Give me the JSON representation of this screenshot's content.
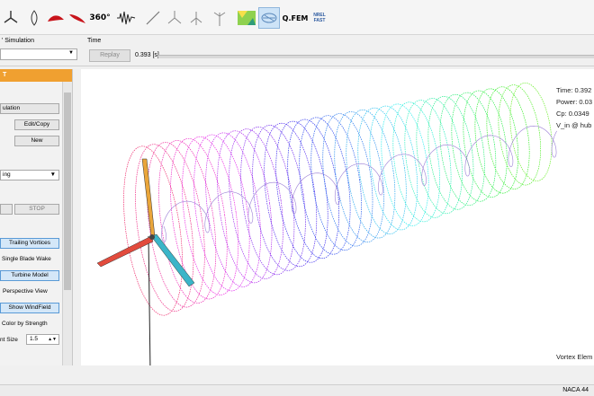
{
  "toolbar": {
    "icons": [
      "turbine-icon",
      "blade-icon",
      "airfoil-red-icon",
      "airfoil-red2-icon",
      "360-label",
      "signal-icon",
      "line-icon",
      "tripod-icon",
      "tower-icon",
      "contour-icon",
      "wake-view-icon",
      "qfem-label",
      "nrel-fast-label"
    ],
    "label_360": "360°",
    "label_qfem": "Q.FEM",
    "label_nrel": "NREL FAST"
  },
  "simulation": {
    "label": "' Simulation",
    "time_label": "Time",
    "replay": "Replay",
    "time_value": "0.393 [s]"
  },
  "panel": {
    "title": "T",
    "simulation_btn": "ulation",
    "edit_copy": "Edit/Copy",
    "new_btn": "New",
    "dropdown": "ing",
    "stop": "STOP",
    "trailing_vortices": "Trailing Vortices",
    "single_blade_wake": "Single Blade Wake",
    "turbine_model": "Turbine Model",
    "perspective_view": "Perspective View",
    "show_windfield": "Show WindField",
    "color_by_strength": "Color by Strength",
    "element_size_label": "nt Size",
    "element_size_value": "1.5"
  },
  "view": {
    "time": "Time: 0.392",
    "power": "Power: 0.03",
    "cp": "Cp: 0.0349",
    "vin": "V_in @ hub",
    "vortex_label": "Vortex Elem"
  },
  "status": {
    "airfoil": "NACA 44"
  },
  "colors": {
    "panel_header": "#f0a030",
    "highlight": "#d4e7f8"
  }
}
